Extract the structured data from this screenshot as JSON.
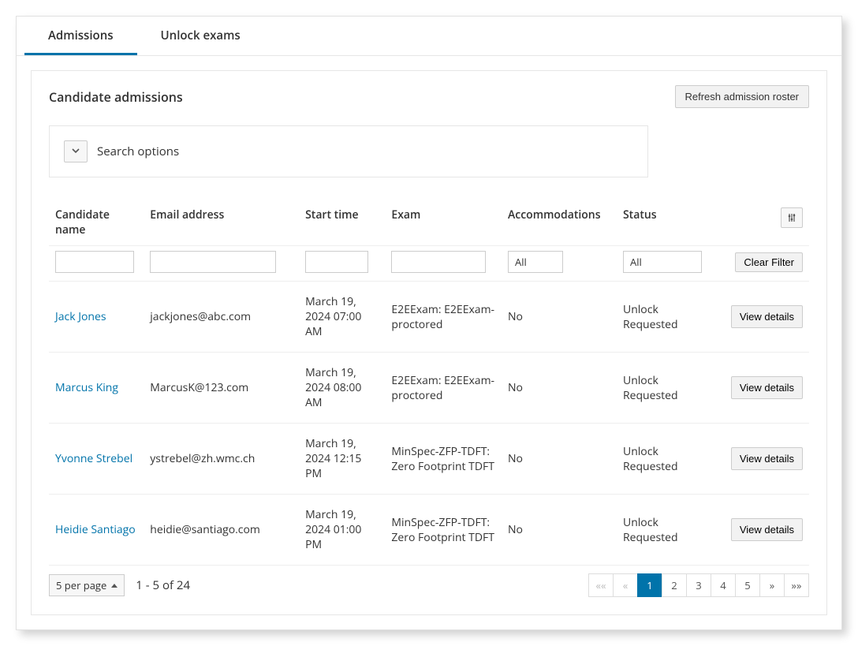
{
  "tabs": [
    {
      "label": "Admissions",
      "active": true
    },
    {
      "label": "Unlock exams",
      "active": false
    }
  ],
  "panel": {
    "title": "Candidate admissions",
    "refresh_label": "Refresh admission roster",
    "search_options_label": "Search options"
  },
  "columns": {
    "candidate_name": "Candidate name",
    "email": "Email address",
    "start_time": "Start time",
    "exam": "Exam",
    "accommodations": "Accommodations",
    "status": "Status"
  },
  "filters": {
    "accommodations_value": "All",
    "status_value": "All",
    "clear_label": "Clear Filter"
  },
  "rows": [
    {
      "name": "Jack Jones",
      "email": "jackjones@abc.com",
      "start": "March 19, 2024 07:00 AM",
      "exam": "E2EExam: E2EExam-proctored",
      "accom": "No",
      "status": "Unlock Requested",
      "action": "View details"
    },
    {
      "name": "Marcus King",
      "email": "MarcusK@123.com",
      "start": "March 19, 2024 08:00 AM",
      "exam": "E2EExam: E2EExam-proctored",
      "accom": "No",
      "status": "Unlock Requested",
      "action": "View details"
    },
    {
      "name": "Yvonne Strebel",
      "email": "ystrebel@zh.wmc.ch",
      "start": "March 19, 2024 12:15 PM",
      "exam": "MinSpec-ZFP-TDFT: Zero Footprint TDFT",
      "accom": "No",
      "status": "Unlock Requested",
      "action": "View details"
    },
    {
      "name": "Heidie Santiago",
      "email": "heidie@santiago.com",
      "start": "March 19, 2024 01:00 PM",
      "exam": "MinSpec-ZFP-TDFT: Zero Footprint TDFT",
      "accom": "No",
      "status": "Unlock Requested",
      "action": "View details"
    }
  ],
  "footer": {
    "per_page_label": "5 per page",
    "range_text": "1 - 5 of 24",
    "pages": [
      "1",
      "2",
      "3",
      "4",
      "5"
    ],
    "active_page": "1",
    "first": "««",
    "prev": "«",
    "next": "»",
    "last": "»»"
  }
}
